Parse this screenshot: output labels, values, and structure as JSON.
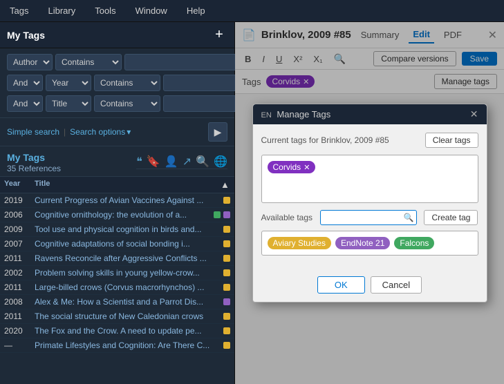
{
  "menubar": {
    "items": [
      "Tags",
      "Library",
      "Tools",
      "Window",
      "Help"
    ]
  },
  "left_panel": {
    "tags_title": "My Tags",
    "add_btn": "+",
    "filters": [
      {
        "conjunction": "",
        "field": "Author",
        "operator": "Contains",
        "value": ""
      },
      {
        "conjunction": "And",
        "field": "Year",
        "operator": "Contains",
        "value": ""
      },
      {
        "conjunction": "And",
        "field": "Title",
        "operator": "Contains",
        "value": ""
      }
    ],
    "search_simple": "Simple search",
    "search_options": "Search options",
    "mytags_label": "My Tags",
    "mytags_count": "35 References",
    "table_cols": [
      "Year",
      "Title"
    ],
    "rows": [
      {
        "year": "2019",
        "title": "Current Progress of Avian Vaccines Against ...",
        "dot": "yellow"
      },
      {
        "year": "2006",
        "title": "Cognitive ornithology: the evolution of a...",
        "dot": "both"
      },
      {
        "year": "2009",
        "title": "Tool use and physical cognition in birds and...",
        "dot": "yellow"
      },
      {
        "year": "2007",
        "title": "Cognitive adaptations of social bonding i...",
        "dot": "yellow"
      },
      {
        "year": "2011",
        "title": "Ravens Reconcile after Aggressive Conflicts ...",
        "dot": "yellow"
      },
      {
        "year": "2002",
        "title": "Problem solving skills in young yellow-crow...",
        "dot": "yellow"
      },
      {
        "year": "2011",
        "title": "Large-billed crows (Corvus macrorhynchos) ...",
        "dot": "yellow"
      },
      {
        "year": "2008",
        "title": "Alex & Me: How a Scientist and a Parrot Dis...",
        "dot": "purple"
      },
      {
        "year": "2011",
        "title": "The social structure of New Caledonian crows",
        "dot": "yellow"
      },
      {
        "year": "2020",
        "title": "The Fox and the Crow. A need to update pe...",
        "dot": "yellow"
      },
      {
        "year": "—",
        "title": "Primate Lifestyles and Cognition: Are There C...",
        "dot": "yellow"
      }
    ]
  },
  "right_panel": {
    "ref_icon": "📄",
    "ref_title": "Brinklov, 2009 #85",
    "tabs": [
      "Summary",
      "Edit",
      "PDF"
    ],
    "active_tab": "Edit",
    "close_icon": "✕",
    "fmt_buttons": [
      "B",
      "I",
      "U",
      "X²",
      "X₁"
    ],
    "compare_label": "Compare versions",
    "save_label": "Save",
    "tags_label": "Tags",
    "current_tag": "Corvids",
    "manage_tags_label": "Manage tags"
  },
  "manage_tags_modal": {
    "lang": "EN",
    "title": "Manage Tags",
    "close_icon": "✕",
    "current_tags_label": "Current tags for Brinklov, 2009 #85",
    "clear_tags_label": "Clear tags",
    "current_tags": [
      "Corvids"
    ],
    "available_tags_label": "Available tags",
    "search_placeholder": "",
    "create_tag_label": "Create tag",
    "available_tags": [
      {
        "name": "Aviary Studies",
        "color": "yellow"
      },
      {
        "name": "EndNote 21",
        "color": "purple"
      },
      {
        "name": "Falcons",
        "color": "green"
      }
    ],
    "ok_label": "OK",
    "cancel_label": "Cancel"
  }
}
